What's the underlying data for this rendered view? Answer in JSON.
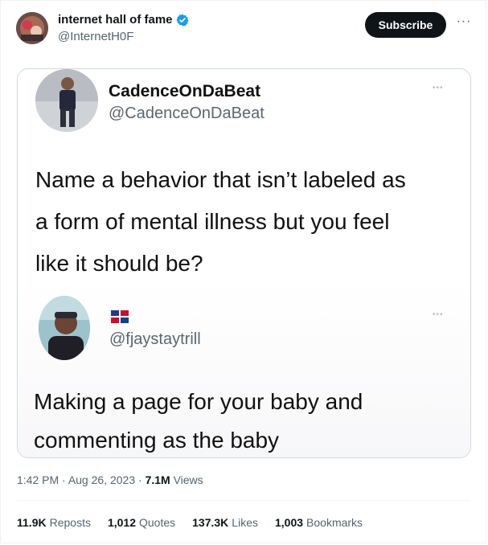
{
  "tweet": {
    "author_name": "internet hall of fame",
    "author_handle": "@InternetH0F",
    "subscribe_label": "Subscribe",
    "more_label": "···"
  },
  "embedded": {
    "question": {
      "name": "CadenceOnDaBeat",
      "handle": "@CadenceOnDaBeat",
      "text": "Name a behavior that isn’t labeled as\na form of mental illness but you feel\nlike it should be?",
      "more_label": "•••"
    },
    "reply": {
      "handle": "@fjaystaytrill",
      "text": "Making a page for your baby and\ncommenting as the baby",
      "more_label": "•••"
    }
  },
  "meta": {
    "time": "1:42 PM",
    "sep1": " · ",
    "date": "Aug 26, 2023",
    "sep2": " · ",
    "views_count": "7.1M",
    "views_label": "Views"
  },
  "stats": [
    {
      "count": "11.9K",
      "label": "Reposts"
    },
    {
      "count": "1,012",
      "label": "Quotes"
    },
    {
      "count": "137.3K",
      "label": "Likes"
    },
    {
      "count": "1,003",
      "label": "Bookmarks"
    }
  ],
  "colors": {
    "verified": "#1d9bf0",
    "text_primary": "#0f1419",
    "text_secondary": "#536471"
  },
  "icons": {
    "verified": "verified-badge-icon",
    "more": "more-horizontal-icon",
    "flag": "dominican-republic-flag-icon"
  }
}
